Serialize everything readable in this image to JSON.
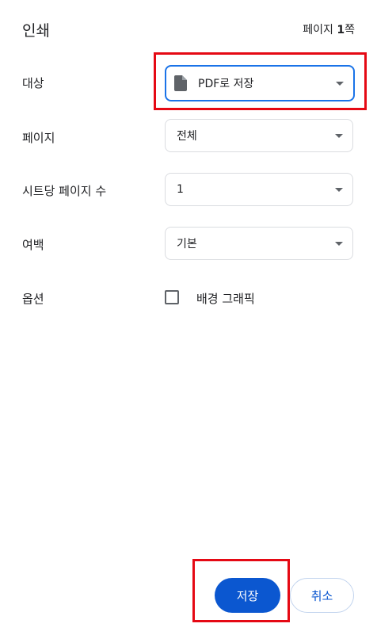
{
  "header": {
    "title": "인쇄",
    "page_count_prefix": "페이지 ",
    "page_count_num": "1",
    "page_count_suffix": "쪽"
  },
  "rows": {
    "destination": {
      "label": "대상",
      "value": "PDF로 저장",
      "icon": "document-icon"
    },
    "pages": {
      "label": "페이지",
      "value": "전체"
    },
    "pages_per_sheet": {
      "label": "시트당 페이지 수",
      "value": "1"
    },
    "margins": {
      "label": "여백",
      "value": "기본"
    },
    "options": {
      "label": "옵션",
      "checkbox_label": "배경 그래픽",
      "checked": false
    }
  },
  "buttons": {
    "save": "저장",
    "cancel": "취소"
  },
  "colors": {
    "accent": "#0b57d0",
    "focus_border": "#1a73e8",
    "highlight": "#e50914"
  }
}
